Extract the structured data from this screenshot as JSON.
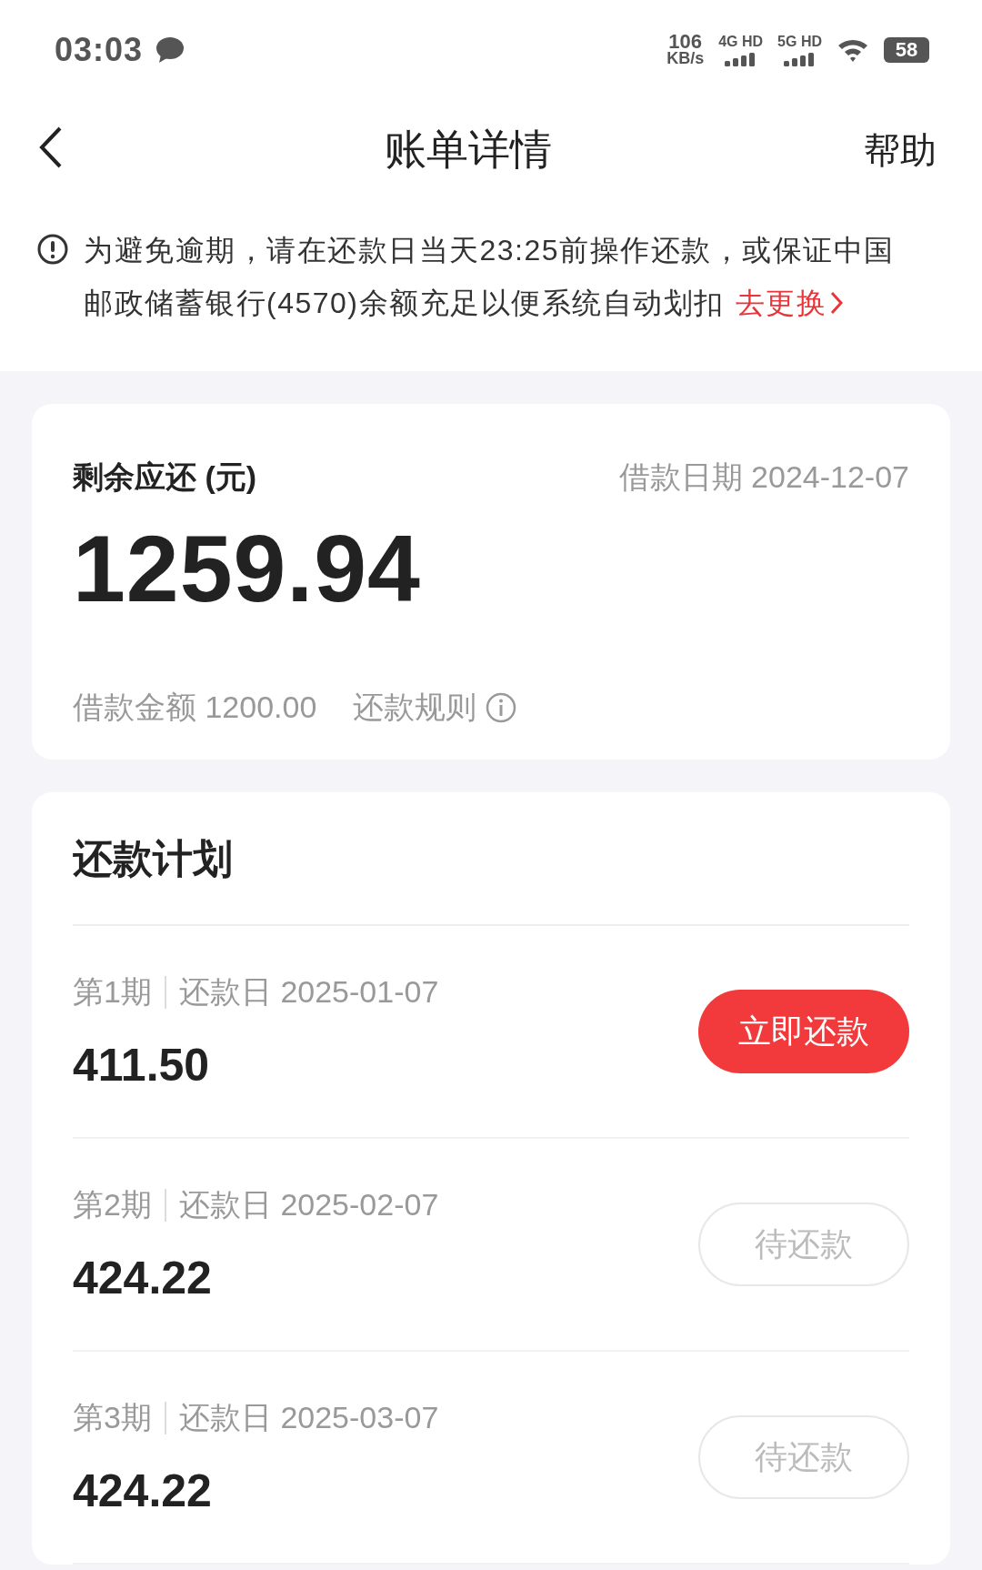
{
  "status_bar": {
    "time": "03:03",
    "speed_value": "106",
    "speed_unit": "KB/s",
    "networks": [
      "4G HD",
      "5G HD"
    ],
    "battery": "58"
  },
  "nav": {
    "title": "账单详情",
    "action": "帮助"
  },
  "notice": {
    "text": "为避免逾期，请在还款日当天23:25前操作还款，或保证中国邮政储蓄银行(4570)余额充足以便系统自动划扣",
    "link": "去更换"
  },
  "summary": {
    "label": "剩余应还 (元)",
    "loan_date_label": "借款日期",
    "loan_date": "2024-12-07",
    "amount": "1259.94",
    "principal_label": "借款金额",
    "principal": "1200.00",
    "rules_link": "还款规则"
  },
  "plan": {
    "title": "还款计划",
    "installments": [
      {
        "period": "第1期",
        "due_label": "还款日",
        "due_date": "2025-01-07",
        "amount": "411.50",
        "kind": "due",
        "action": "立即还款"
      },
      {
        "period": "第2期",
        "due_label": "还款日",
        "due_date": "2025-02-07",
        "amount": "424.22",
        "kind": "pending",
        "action": "待还款"
      },
      {
        "period": "第3期",
        "due_label": "还款日",
        "due_date": "2025-03-07",
        "amount": "424.22",
        "kind": "pending",
        "action": "待还款"
      }
    ]
  }
}
